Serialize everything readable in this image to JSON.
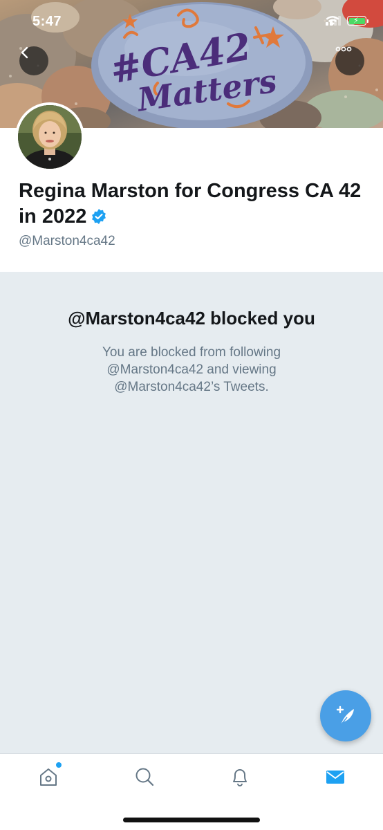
{
  "status_bar": {
    "time": "5:47"
  },
  "banner": {
    "rock_text_line1": "#CA42",
    "rock_text_line2": "Matters"
  },
  "profile": {
    "display_name": "Regina Marston for Congress CA 42 in 2022",
    "handle": "@Marston4ca42",
    "verified": true
  },
  "blocked": {
    "title": "@Marston4ca42 blocked you",
    "description": "You are blocked from following @Marston4ca42 and viewing @Marston4ca42’s Tweets."
  },
  "tabbar": {
    "items": [
      "home-icon",
      "search-icon",
      "bell-icon",
      "mail-icon"
    ],
    "active": "mail-icon",
    "home_has_notification_dot": true
  },
  "colors": {
    "twitter_blue": "#1da1f2",
    "fab_blue": "#4a9fe6",
    "blocked_bg": "#e6ecf0",
    "secondary_text": "#657786"
  }
}
